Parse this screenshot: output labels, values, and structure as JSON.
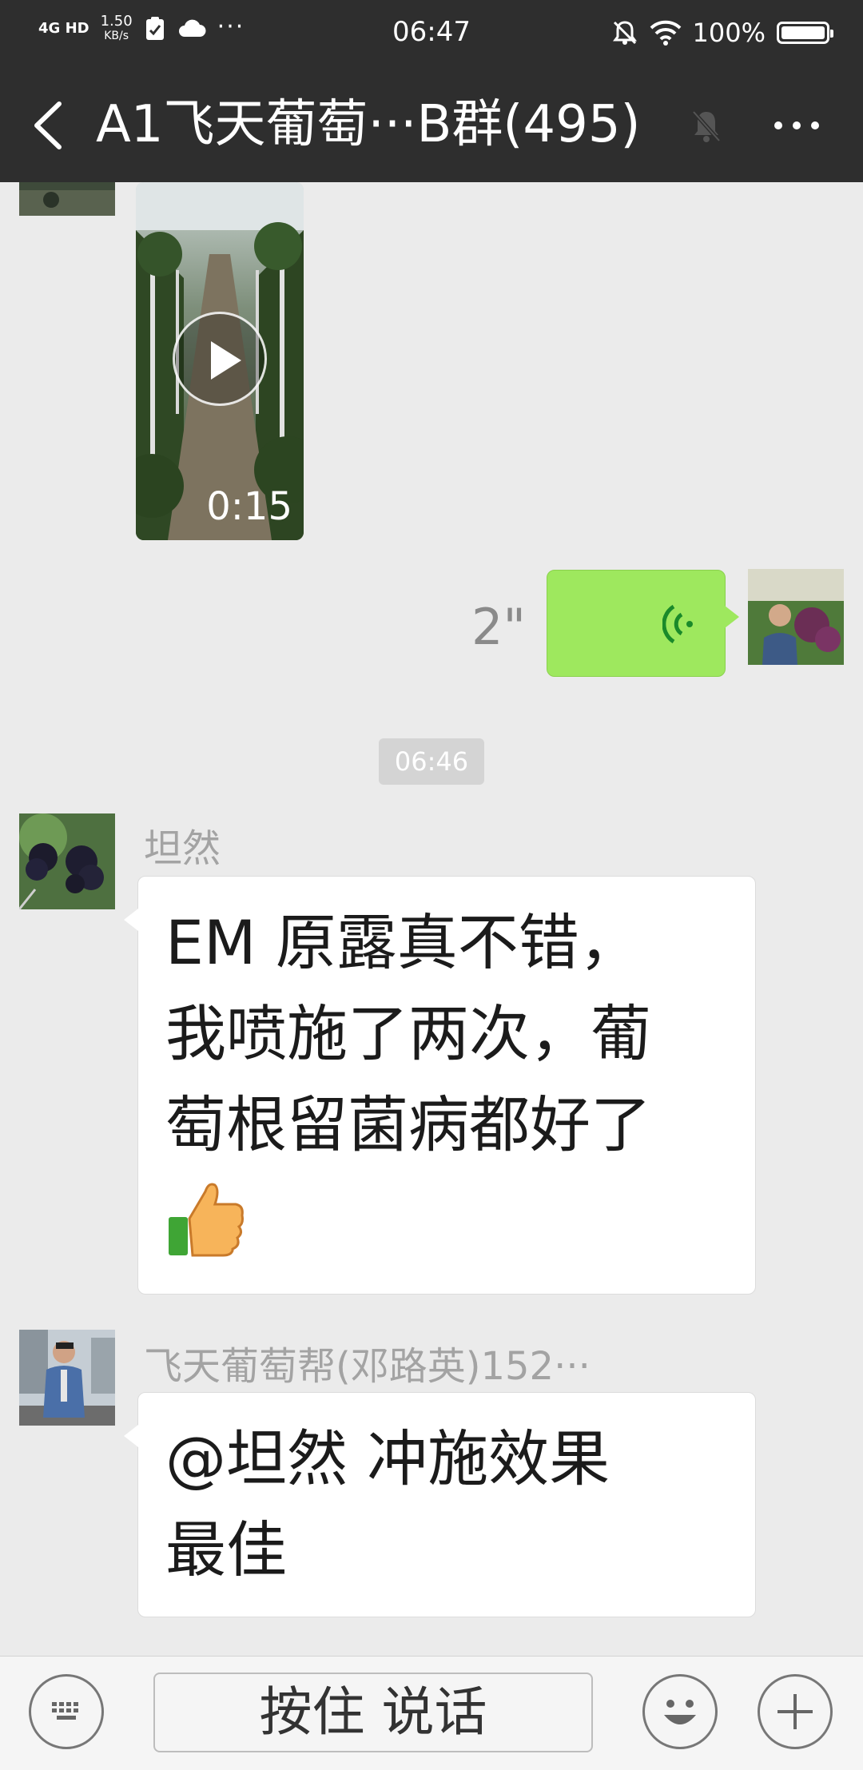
{
  "status_bar": {
    "network": "4G HD",
    "speed_value": "1.50",
    "speed_unit": "KB/s",
    "time": "06:47",
    "battery": "100%",
    "icons": [
      "signal-icon",
      "sim-check-icon",
      "cloud-icon",
      "more-dots-icon",
      "bell-off-icon",
      "wifi-icon",
      "battery-icon"
    ]
  },
  "header": {
    "title": "A1飞天葡萄···B群(495)",
    "back_icon": "chevron-left-icon",
    "mute_icon": "bell-off-icon",
    "more_icon": "more-dots-icon"
  },
  "messages": {
    "video": {
      "duration": "0:15"
    },
    "voice": {
      "duration": "2\""
    },
    "timestamp": "06:46",
    "msg1": {
      "sender": "坦然",
      "line1": "EM 原露真不错，",
      "line2": "我喷施了两次，葡",
      "line3": "萄根留菌病都好了",
      "emoji": "thumbs-up-icon"
    },
    "msg2": {
      "sender": "飞天葡萄帮(邓路英)152···",
      "line1": "@坦然  冲施效果",
      "line2": "最佳"
    }
  },
  "input_bar": {
    "talk_label": "按住 说话",
    "icons": [
      "keyboard-icon",
      "emoji-icon",
      "plus-icon"
    ]
  }
}
